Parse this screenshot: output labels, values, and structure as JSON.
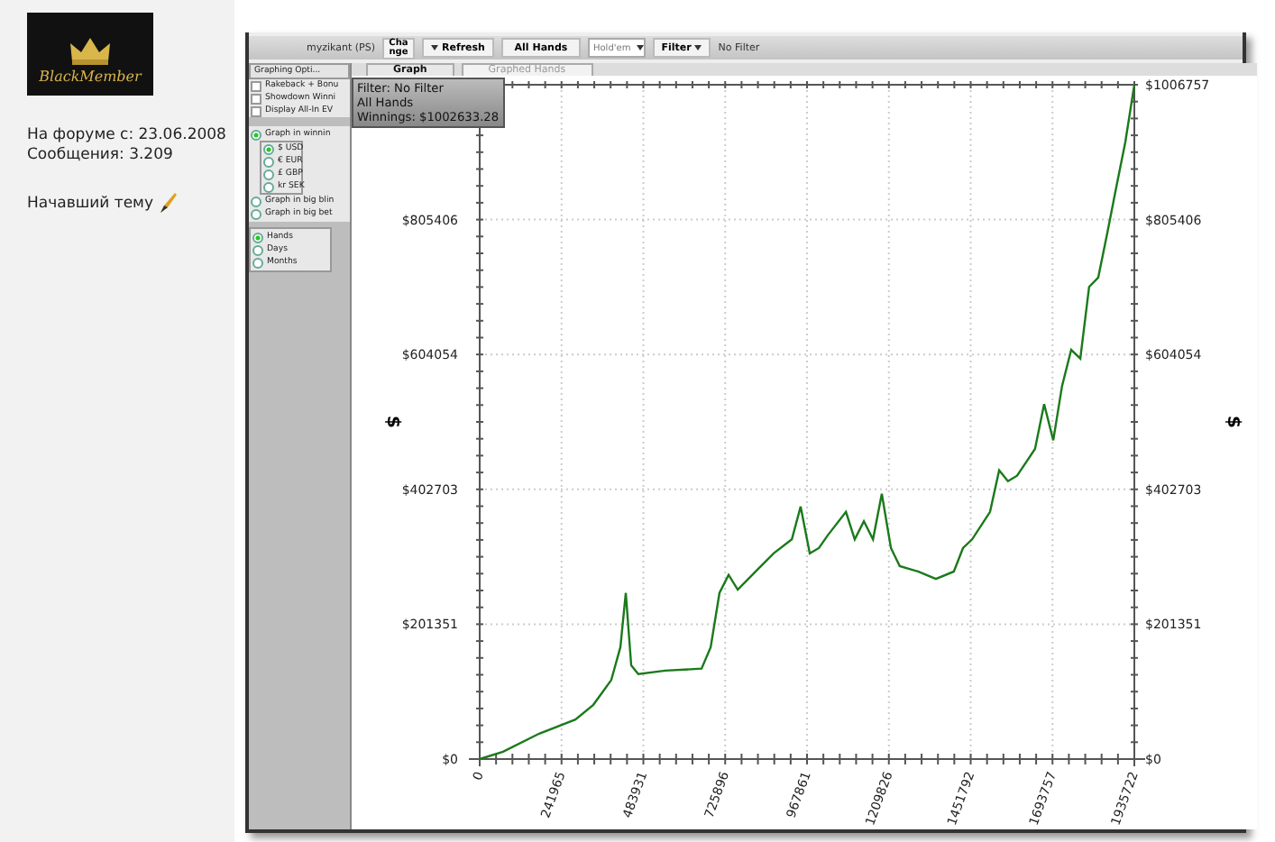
{
  "profile": {
    "logo_text": "BlackMember",
    "member_since": "На форуме с: 23.06.2008",
    "posts": "Сообщения: 3.209",
    "topic_starter": "Начавший тему"
  },
  "toolbar": {
    "player": "myzikant (PS)",
    "change_button": "Change",
    "refresh_button": "Refresh",
    "hands_button": "All Hands",
    "game_select": "Hold'em",
    "filter_button": "Filter",
    "filter_value": "No Filter"
  },
  "options": {
    "title": "Graphing Opti...",
    "checkboxes": [
      {
        "label": "Rakeback + Bonu",
        "checked": false
      },
      {
        "label": "Showdown Winni",
        "checked": false
      },
      {
        "label": "Display All-In EV",
        "checked": false
      }
    ],
    "modes": [
      {
        "label": "Graph in winnin",
        "selected": true,
        "currencies": [
          {
            "label": "$ USD",
            "selected": true
          },
          {
            "label": "€ EUR",
            "selected": false
          },
          {
            "label": "£ GBP",
            "selected": false
          },
          {
            "label": "kr SEK",
            "selected": false
          }
        ]
      },
      {
        "label": "Graph in big blin",
        "selected": false
      },
      {
        "label": "Graph in big bet",
        "selected": false
      }
    ],
    "x_units": [
      {
        "label": "Hands",
        "selected": true
      },
      {
        "label": "Days",
        "selected": false
      },
      {
        "label": "Months",
        "selected": false
      }
    ]
  },
  "tabs": [
    {
      "label": "Graph",
      "selected": true
    },
    {
      "label": "Graphed Hands",
      "selected": false
    }
  ],
  "summary": {
    "filter": "Filter: No Filter",
    "hands": "All Hands",
    "winnings": "Winnings: $1002633.28"
  },
  "left_axis_labels": [
    "$805406",
    "$604054",
    "$402703",
    "$201351",
    "$0"
  ],
  "chart_data": {
    "type": "line",
    "ylabel": "$",
    "grid": true,
    "xlim": [
      0,
      1935722
    ],
    "ylim": [
      0,
      1006757
    ],
    "xticks": [
      0,
      241965,
      483931,
      725896,
      967861,
      1209826,
      1451792,
      1693757,
      1935722
    ],
    "yticks": [
      {
        "value": 0,
        "label": "$0"
      },
      {
        "value": 201351,
        "label": "$201351"
      },
      {
        "value": 402703,
        "label": "$402703"
      },
      {
        "value": 604054,
        "label": "$604054"
      },
      {
        "value": 805406,
        "label": "$805406"
      },
      {
        "value": 1006757,
        "label": "$1006757"
      }
    ],
    "x": [
      0,
      69000,
      176000,
      283000,
      336000,
      389000,
      416000,
      432000,
      448000,
      469000,
      549000,
      656000,
      683000,
      709000,
      736000,
      763000,
      816000,
      869000,
      923000,
      949000,
      976000,
      1003000,
      1029000,
      1083000,
      1109000,
      1136000,
      1163000,
      1189000,
      1216000,
      1242000,
      1296000,
      1349000,
      1402000,
      1429000,
      1456000,
      1509000,
      1536000,
      1562000,
      1589000,
      1642000,
      1669000,
      1696000,
      1722000,
      1749000,
      1776000,
      1802000,
      1829000,
      1856000,
      1882000,
      1909000,
      1935722
    ],
    "series": [
      {
        "color": "#1a7a1a",
        "values": [
          0,
          11000,
          38000,
          59000,
          81000,
          118000,
          167000,
          248000,
          140000,
          127000,
          132000,
          135000,
          167000,
          248000,
          275000,
          253000,
          280000,
          307000,
          328000,
          377000,
          307000,
          315000,
          334000,
          369000,
          328000,
          355000,
          328000,
          396000,
          315000,
          288000,
          280000,
          269000,
          280000,
          315000,
          328000,
          369000,
          431000,
          415000,
          423000,
          463000,
          530000,
          476000,
          557000,
          611000,
          598000,
          705000,
          719000,
          786000,
          853000,
          921000,
          1006757
        ]
      }
    ]
  }
}
